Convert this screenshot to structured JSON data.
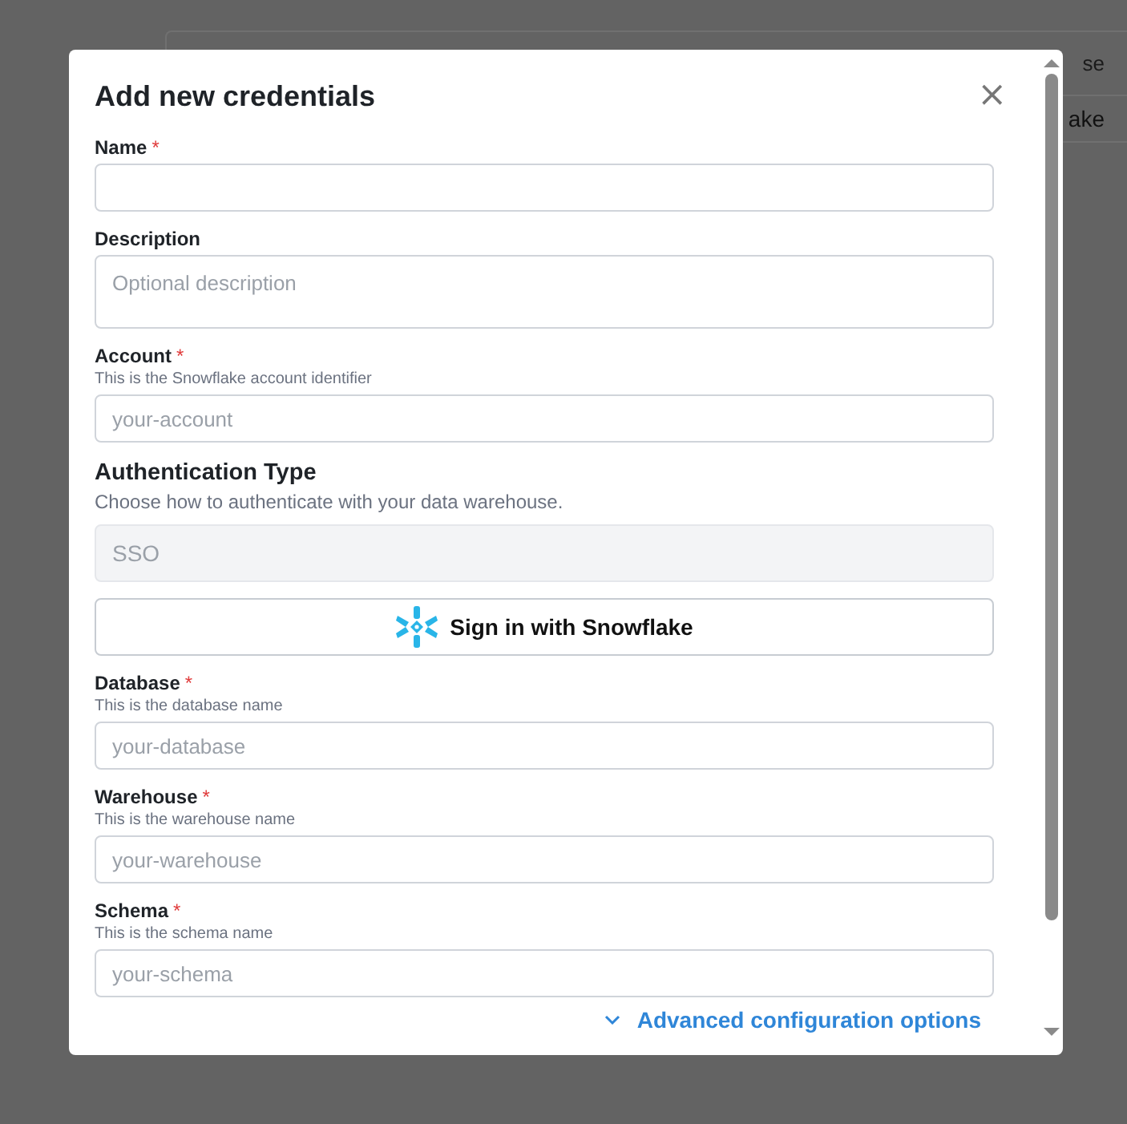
{
  "background": {
    "column_header": "se",
    "cell": "ake"
  },
  "modal": {
    "title": "Add new credentials",
    "close": "×",
    "form": [
      {
        "kind": "input",
        "label": "Name",
        "required_mark": "*"
      },
      {
        "kind": "textarea",
        "label": "Description",
        "placeholder": "Optional description"
      },
      {
        "kind": "input",
        "label": "Account",
        "required_mark": "*",
        "hint": "This is the Snowflake account identifier",
        "placeholder": "your-account"
      },
      {
        "kind": "section",
        "title": "Authentication Type",
        "subtitle": "Choose how to authenticate with your data warehouse."
      },
      {
        "kind": "select",
        "value": "SSO",
        "disabled": true
      },
      {
        "kind": "signin",
        "label": "Sign in with Snowflake"
      },
      {
        "kind": "input",
        "label": "Database",
        "required_mark": "*",
        "hint": "This is the database name",
        "placeholder": "your-database"
      },
      {
        "kind": "input",
        "label": "Warehouse",
        "required_mark": "*",
        "hint": "This is the warehouse name",
        "placeholder": "your-warehouse"
      },
      {
        "kind": "input",
        "label": "Schema",
        "required_mark": "*",
        "hint": "This is the schema name",
        "placeholder": "your-schema"
      }
    ],
    "advanced_link": "Advanced configuration options"
  }
}
